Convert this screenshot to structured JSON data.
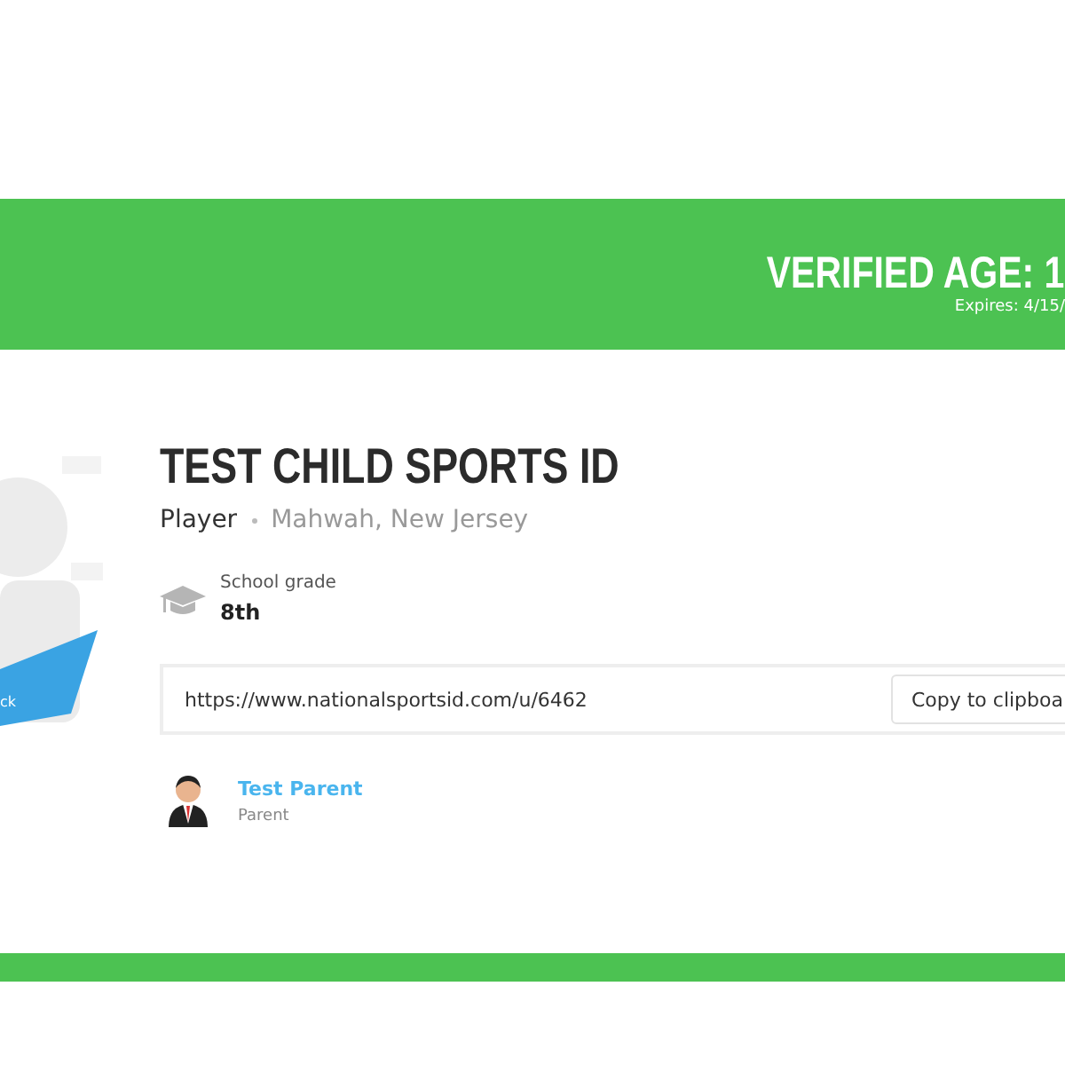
{
  "banner": {
    "title": "VERIFIED AGE: 1",
    "expires": "Expires: 4/15/"
  },
  "avatar": {
    "ribbon": "ck"
  },
  "profile": {
    "name": "TEST CHILD SPORTS ID",
    "role": "Player",
    "location": "Mahwah, New Jersey"
  },
  "grade": {
    "label": "School grade",
    "value": "8th"
  },
  "link": {
    "value": "https://www.nationalsportsid.com/u/6462",
    "button": "Copy to clipboa"
  },
  "guardian": {
    "name": "Test Parent",
    "relation": "Parent"
  }
}
